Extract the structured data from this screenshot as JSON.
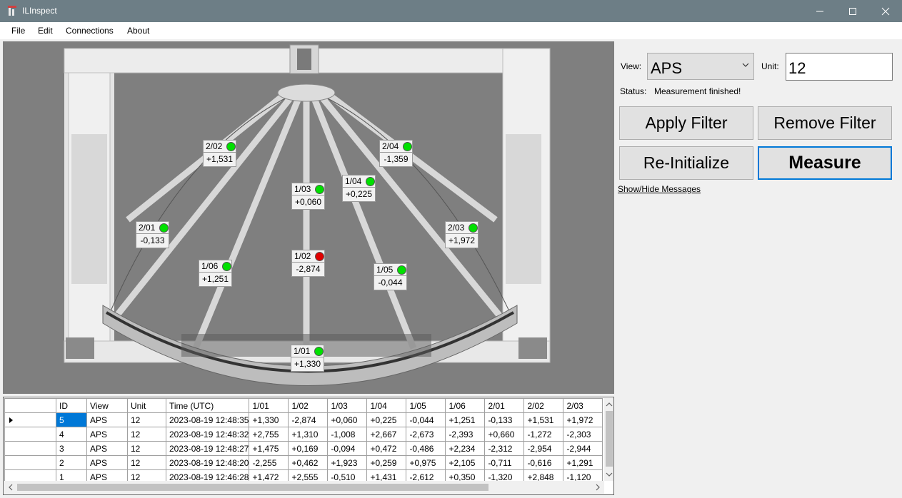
{
  "window": {
    "title": "ILInspect"
  },
  "menu": [
    "File",
    "Edit",
    "Connections",
    "About"
  ],
  "sensors": [
    {
      "id": "2/02",
      "value": "+1,531",
      "status": "ok"
    },
    {
      "id": "2/04",
      "value": "-1,359",
      "status": "ok"
    },
    {
      "id": "1/03",
      "value": "+0,060",
      "status": "ok"
    },
    {
      "id": "1/04",
      "value": "+0,225",
      "status": "ok"
    },
    {
      "id": "2/01",
      "value": "-0,133",
      "status": "ok"
    },
    {
      "id": "2/03",
      "value": "+1,972",
      "status": "ok"
    },
    {
      "id": "1/02",
      "value": "-2,874",
      "status": "error"
    },
    {
      "id": "1/06",
      "value": "+1,251",
      "status": "ok"
    },
    {
      "id": "1/05",
      "value": "-0,044",
      "status": "ok"
    },
    {
      "id": "1/01",
      "value": "+1,330",
      "status": "ok"
    }
  ],
  "status_colors": {
    "ok": "#00e000",
    "error": "#e00000"
  },
  "controls": {
    "view_label": "View:",
    "view_value": "APS",
    "unit_label": "Unit:",
    "unit_value": "12",
    "status_label": "Status:",
    "status_value": "Measurement finished!",
    "apply_filter": "Apply Filter",
    "remove_filter": "Remove Filter",
    "reinitialize": "Re-Initialize",
    "measure": "Measure",
    "show_hide": "Show/Hide Messages"
  },
  "table": {
    "columns": [
      "",
      "ID",
      "View",
      "Unit",
      "Time (UTC)",
      "1/01",
      "1/02",
      "1/03",
      "1/04",
      "1/05",
      "1/06",
      "2/01",
      "2/02",
      "2/03"
    ],
    "rows": [
      [
        "",
        "5",
        "APS",
        "12",
        "2023-08-19 12:48:35",
        "+1,330",
        "-2,874",
        "+0,060",
        "+0,225",
        "-0,044",
        "+1,251",
        "-0,133",
        "+1,531",
        "+1,972"
      ],
      [
        "",
        "4",
        "APS",
        "12",
        "2023-08-19 12:48:32",
        "+2,755",
        "+1,310",
        "-1,008",
        "+2,667",
        "-2,673",
        "-2,393",
        "+0,660",
        "-1,272",
        "-2,303"
      ],
      [
        "",
        "3",
        "APS",
        "12",
        "2023-08-19 12:48:27",
        "+1,475",
        "+0,169",
        "-0,094",
        "+0,472",
        "-0,486",
        "+2,234",
        "-2,312",
        "-2,954",
        "-2,944"
      ],
      [
        "",
        "2",
        "APS",
        "12",
        "2023-08-19 12:48:20",
        "-2,255",
        "+0,462",
        "+1,923",
        "+0,259",
        "+0,975",
        "+2,105",
        "-0,711",
        "-0,616",
        "+1,291"
      ],
      [
        "",
        "1",
        "APS",
        "12",
        "2023-08-19 12:46:28",
        "+1,472",
        "+2,555",
        "-0,510",
        "+1,431",
        "-2,612",
        "+0,350",
        "-1,320",
        "+2,848",
        "-1,120"
      ]
    ]
  }
}
